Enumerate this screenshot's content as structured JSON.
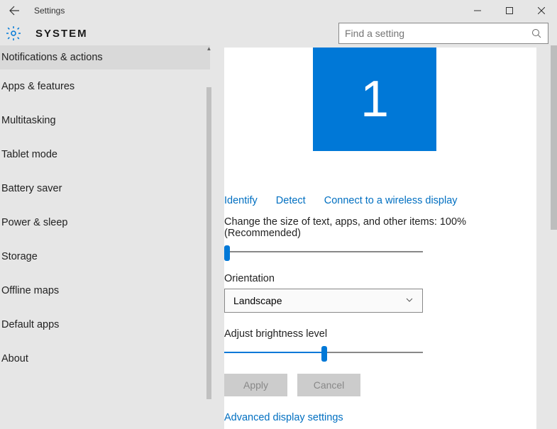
{
  "window": {
    "title": "Settings"
  },
  "header": {
    "title": "SYSTEM"
  },
  "search": {
    "placeholder": "Find a setting"
  },
  "sidebar": {
    "items": [
      {
        "label": "Notifications & actions",
        "selected": true
      },
      {
        "label": "Apps & features"
      },
      {
        "label": "Multitasking"
      },
      {
        "label": "Tablet mode"
      },
      {
        "label": "Battery saver"
      },
      {
        "label": "Power & sleep"
      },
      {
        "label": "Storage"
      },
      {
        "label": "Offline maps"
      },
      {
        "label": "Default apps"
      },
      {
        "label": "About"
      }
    ]
  },
  "display": {
    "monitor_number": "1",
    "link_identify": "Identify",
    "link_detect": "Detect",
    "link_wireless": "Connect to a wireless display",
    "scale_label": "Change the size of text, apps, and other items: 100% (Recommended)",
    "scale_slider_pct": 2,
    "orientation_label": "Orientation",
    "orientation_value": "Landscape",
    "brightness_label": "Adjust brightness level",
    "brightness_slider_pct": 50,
    "apply_label": "Apply",
    "cancel_label": "Cancel",
    "advanced_link": "Advanced display settings"
  },
  "colors": {
    "accent": "#0078d7",
    "link": "#006fc1"
  }
}
